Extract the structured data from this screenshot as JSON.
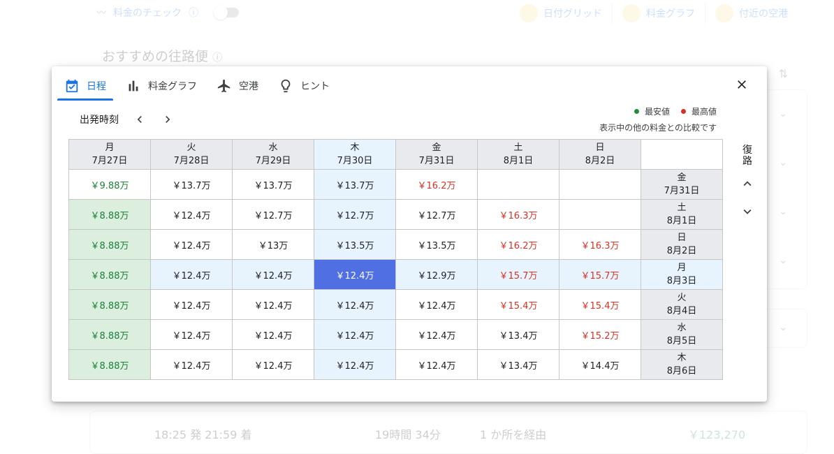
{
  "background": {
    "price_check_label": "料金のチェック",
    "view_tabs": [
      {
        "label": "日付グリッド"
      },
      {
        "label": "料金グラフ"
      },
      {
        "label": "付近の空港"
      }
    ],
    "section_title": "おすすめの往路便",
    "flight": {
      "times": "18:25 発 21:59 着",
      "duration": "19時間 34分",
      "stops": "1 か所を経由",
      "price": "￥123,270"
    }
  },
  "dialog": {
    "tabs": [
      {
        "label": "日程",
        "icon": "calendar-check-icon",
        "active": true
      },
      {
        "label": "料金グラフ",
        "icon": "bar-chart-icon",
        "active": false
      },
      {
        "label": "空港",
        "icon": "airplane-icon",
        "active": false
      },
      {
        "label": "ヒント",
        "icon": "lightbulb-icon",
        "active": false
      }
    ],
    "departure_label": "出発時刻",
    "return_label": "復路",
    "legend": {
      "lowest_label": "最安値",
      "highest_label": "最高値",
      "note": "表示中の他の料金との比較です",
      "lowest_color": "#1e8e3e",
      "highest_color": "#d93025"
    },
    "grid": {
      "columns": [
        {
          "dow": "月",
          "date": "7月27日"
        },
        {
          "dow": "火",
          "date": "7月28日"
        },
        {
          "dow": "水",
          "date": "7月29日"
        },
        {
          "dow": "木",
          "date": "7月30日"
        },
        {
          "dow": "金",
          "date": "7月31日"
        },
        {
          "dow": "土",
          "date": "8月1日"
        },
        {
          "dow": "日",
          "date": "8月2日"
        }
      ],
      "rows": [
        {
          "dow": "金",
          "date": "7月31日",
          "prices": [
            "￥9.88万",
            "￥13.7万",
            "￥13.7万",
            "￥13.7万",
            "￥16.2万",
            "",
            ""
          ]
        },
        {
          "dow": "土",
          "date": "8月1日",
          "prices": [
            "￥8.88万",
            "￥12.4万",
            "￥12.7万",
            "￥12.7万",
            "￥12.7万",
            "￥16.3万",
            ""
          ]
        },
        {
          "dow": "日",
          "date": "8月2日",
          "prices": [
            "￥8.88万",
            "￥12.4万",
            "￥13万",
            "￥13.5万",
            "￥13.5万",
            "￥16.2万",
            "￥16.3万"
          ]
        },
        {
          "dow": "月",
          "date": "8月3日",
          "prices": [
            "￥8.88万",
            "￥12.4万",
            "￥12.4万",
            "￥12.4万",
            "￥12.9万",
            "￥15.7万",
            "￥15.7万"
          ]
        },
        {
          "dow": "火",
          "date": "8月4日",
          "prices": [
            "￥8.88万",
            "￥12.4万",
            "￥12.4万",
            "￥12.4万",
            "￥12.4万",
            "￥15.4万",
            "￥15.4万"
          ]
        },
        {
          "dow": "水",
          "date": "8月5日",
          "prices": [
            "￥8.88万",
            "￥12.4万",
            "￥12.4万",
            "￥12.4万",
            "￥12.4万",
            "￥13.4万",
            "￥15.2万"
          ]
        },
        {
          "dow": "木",
          "date": "8月6日",
          "prices": [
            "￥8.88万",
            "￥12.4万",
            "￥12.4万",
            "￥12.4万",
            "￥12.4万",
            "￥13.4万",
            "￥14.4万"
          ]
        }
      ],
      "selected": {
        "row": 3,
        "col": 3
      },
      "lowest_cells": [
        [
          0,
          0
        ],
        [
          1,
          0
        ],
        [
          2,
          0
        ],
        [
          3,
          0
        ],
        [
          4,
          0
        ],
        [
          5,
          0
        ],
        [
          6,
          0
        ]
      ],
      "highest_cells": [
        [
          0,
          4
        ],
        [
          1,
          5
        ],
        [
          2,
          5
        ],
        [
          2,
          6
        ],
        [
          3,
          5
        ],
        [
          3,
          6
        ],
        [
          4,
          5
        ],
        [
          4,
          6
        ],
        [
          5,
          6
        ]
      ]
    }
  }
}
